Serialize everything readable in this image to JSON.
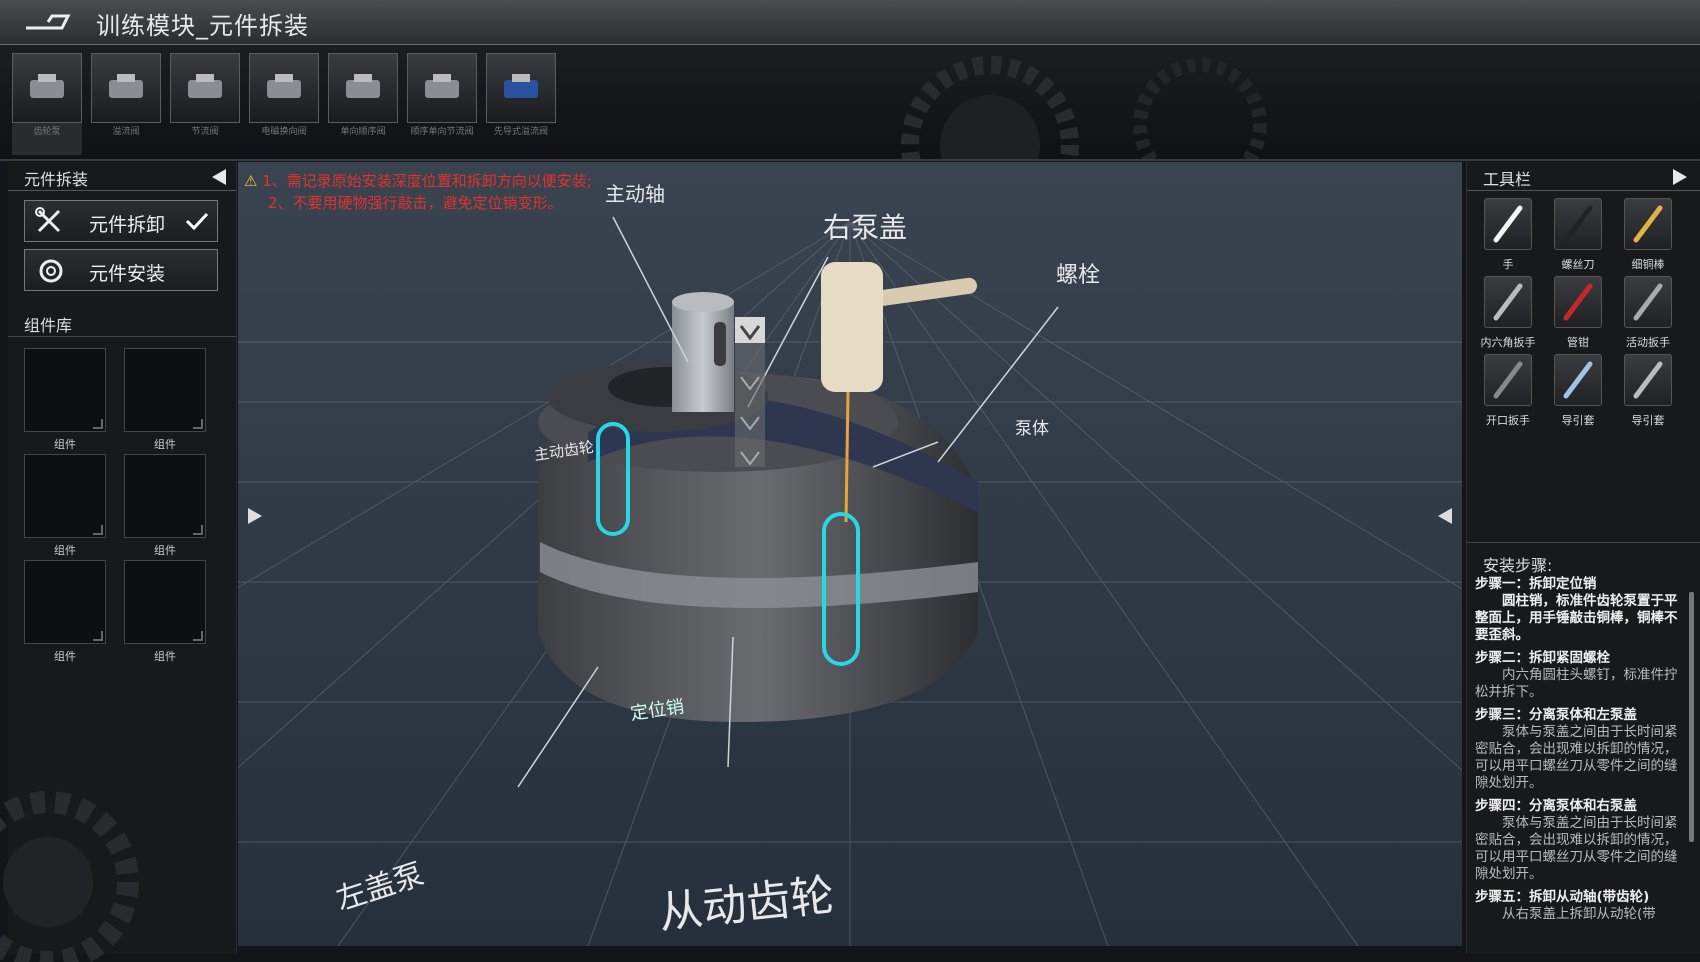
{
  "window": {
    "title": "训练模块_元件拆装"
  },
  "top_strip": {
    "components": [
      {
        "label": "齿轮泵",
        "icon": "gear-pump-icon",
        "selected": true
      },
      {
        "label": "溢流阀",
        "icon": "relief-valve-icon",
        "selected": false
      },
      {
        "label": "节流阀",
        "icon": "throttle-valve-icon",
        "selected": false
      },
      {
        "label": "电磁换向阀",
        "icon": "solenoid-valve-icon",
        "selected": false
      },
      {
        "label": "单向顺序阀",
        "icon": "sequence-valve-icon",
        "selected": false
      },
      {
        "label": "顺序单向节流阀",
        "icon": "check-throttle-valve-icon",
        "selected": false
      },
      {
        "label": "先导式溢流阀",
        "icon": "pilot-valve-icon",
        "selected": false
      }
    ]
  },
  "left_panel": {
    "title": "元件拆装",
    "disassemble_label": "元件拆卸",
    "install_label": "元件安装",
    "library_title": "组件库",
    "slots": [
      "组件",
      "组件",
      "组件",
      "组件",
      "组件",
      "组件"
    ]
  },
  "viewport": {
    "warning_1": "1、需记录原始安装深度位置和拆卸方向以便安装;",
    "warning_2": "2、不要用硬物强行敲击，避免定位销变形。",
    "labels": {
      "drive_shaft": "主动轴",
      "right_cover": "右泵盖",
      "bolt": "螺栓",
      "drive_gear": "主动齿轮",
      "pump_body": "泵体",
      "dowel_pin": "定位销",
      "left_cover": "左盖泵",
      "driven_gear": "从动齿轮"
    },
    "highlight_color": "#28d6e6"
  },
  "right_panel": {
    "title": "工具栏",
    "tools": [
      {
        "label": "手",
        "icon": "hand-icon"
      },
      {
        "label": "螺丝刀",
        "icon": "screwdriver-icon"
      },
      {
        "label": "细铜棒",
        "icon": "copper-rod-icon"
      },
      {
        "label": "内六角扳手",
        "icon": "hex-key-icon"
      },
      {
        "label": "管钳",
        "icon": "pipe-wrench-icon"
      },
      {
        "label": "活动扳手",
        "icon": "adjustable-wrench-icon"
      },
      {
        "label": "开口扳手",
        "icon": "open-wrench-icon"
      },
      {
        "label": "导引套",
        "icon": "guide-sleeve-icon"
      },
      {
        "label": "导引套",
        "icon": "guide-rod-icon"
      }
    ],
    "steps_title": "安装步骤:",
    "steps": [
      {
        "title": "步骤一：拆卸定位销",
        "body": "圆柱销，标准件齿轮泵置于平整面上，用手锤敲击铜棒，铜棒不要歪斜。"
      },
      {
        "title": "步骤二：拆卸紧固螺栓",
        "body": "内六角圆柱头螺钉，标准件拧松并拆下。"
      },
      {
        "title": "步骤三：分离泵体和左泵盖",
        "body": "泵体与泵盖之间由于长时间紧密贴合，会出现难以拆卸的情况，可以用平口螺丝刀从零件之间的缝隙处划开。"
      },
      {
        "title": "步骤四：分离泵体和右泵盖",
        "body": "泵体与泵盖之间由于长时间紧密贴合，会出现难以拆卸的情况，可以用平口螺丝刀从零件之间的缝隙处划开。"
      },
      {
        "title": "步骤五：拆卸从动轴(带齿轮)",
        "body": "从右泵盖上拆卸从动轮(带"
      }
    ]
  }
}
